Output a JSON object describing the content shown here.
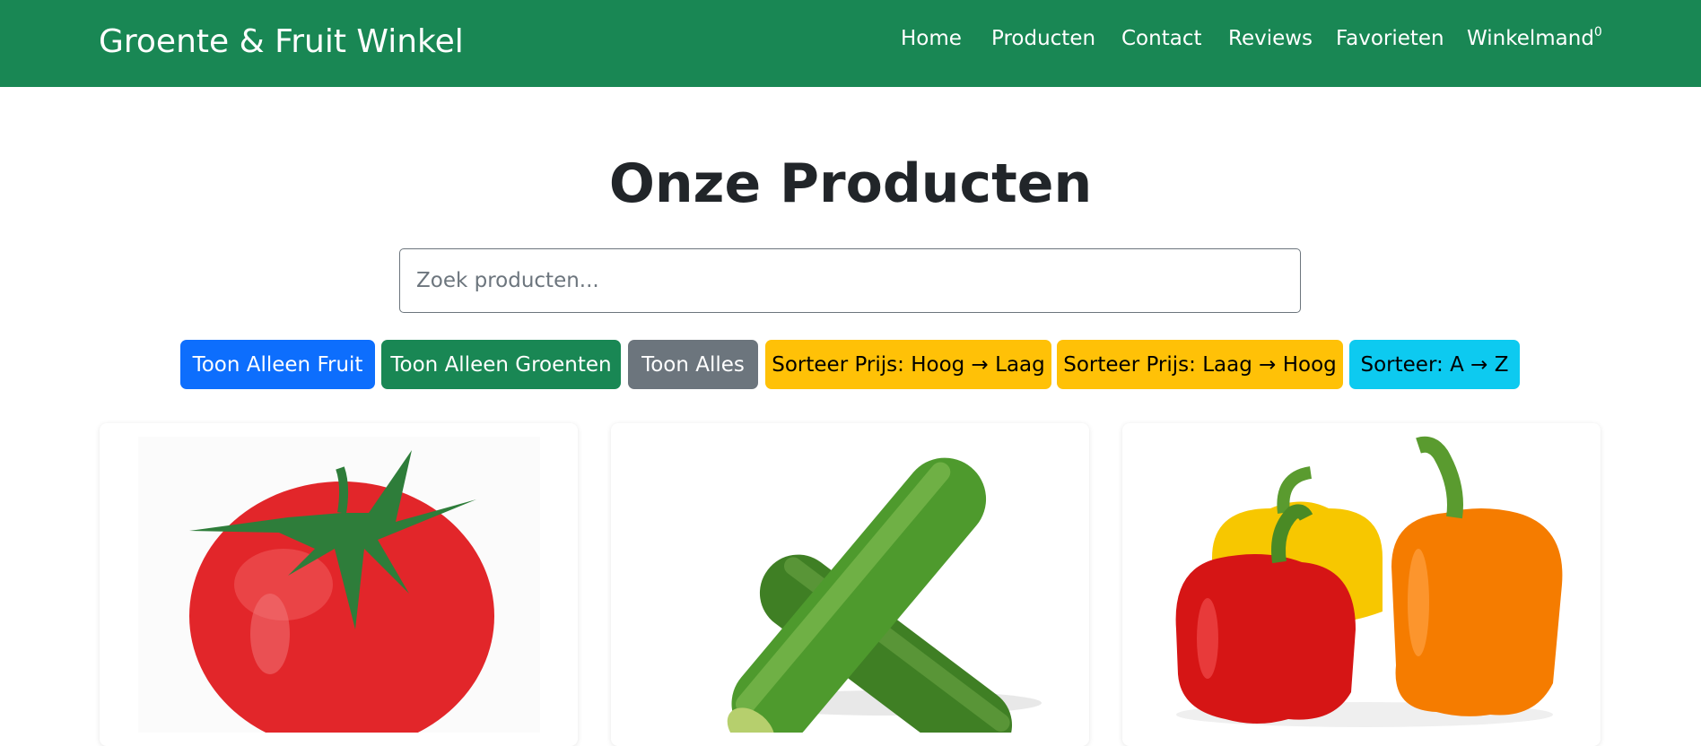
{
  "navbar": {
    "brand": "Groente & Fruit Winkel",
    "links": [
      "Home",
      "Producten",
      "Contact",
      "Reviews",
      "Favorieten"
    ],
    "cart_label": "Winkelmand",
    "cart_count": "0"
  },
  "main": {
    "title": "Onze Producten",
    "search_placeholder": "Zoek producten...",
    "filters": [
      {
        "label": "Toon Alleen Fruit",
        "color": "#0d6efd",
        "text_color": "#ffffff"
      },
      {
        "label": "Toon Alleen Groenten",
        "color": "#198754",
        "text_color": "#ffffff"
      },
      {
        "label": "Toon Alles",
        "color": "#6c757d",
        "text_color": "#ffffff"
      },
      {
        "label": "Sorteer Prijs: Hoog → Laag",
        "color": "#ffc107",
        "text_color": "#000000"
      },
      {
        "label": "Sorteer Prijs: Laag → Hoog",
        "color": "#ffc107",
        "text_color": "#000000"
      },
      {
        "label": "Sorteer: A → Z",
        "color": "#0dcaf0",
        "text_color": "#000000"
      }
    ],
    "products": [
      {
        "image": "tomato-image"
      },
      {
        "image": "cucumber-image"
      },
      {
        "image": "bell-peppers-image"
      }
    ]
  },
  "colors": {
    "navbar": "#198754",
    "accent": "#198754"
  }
}
